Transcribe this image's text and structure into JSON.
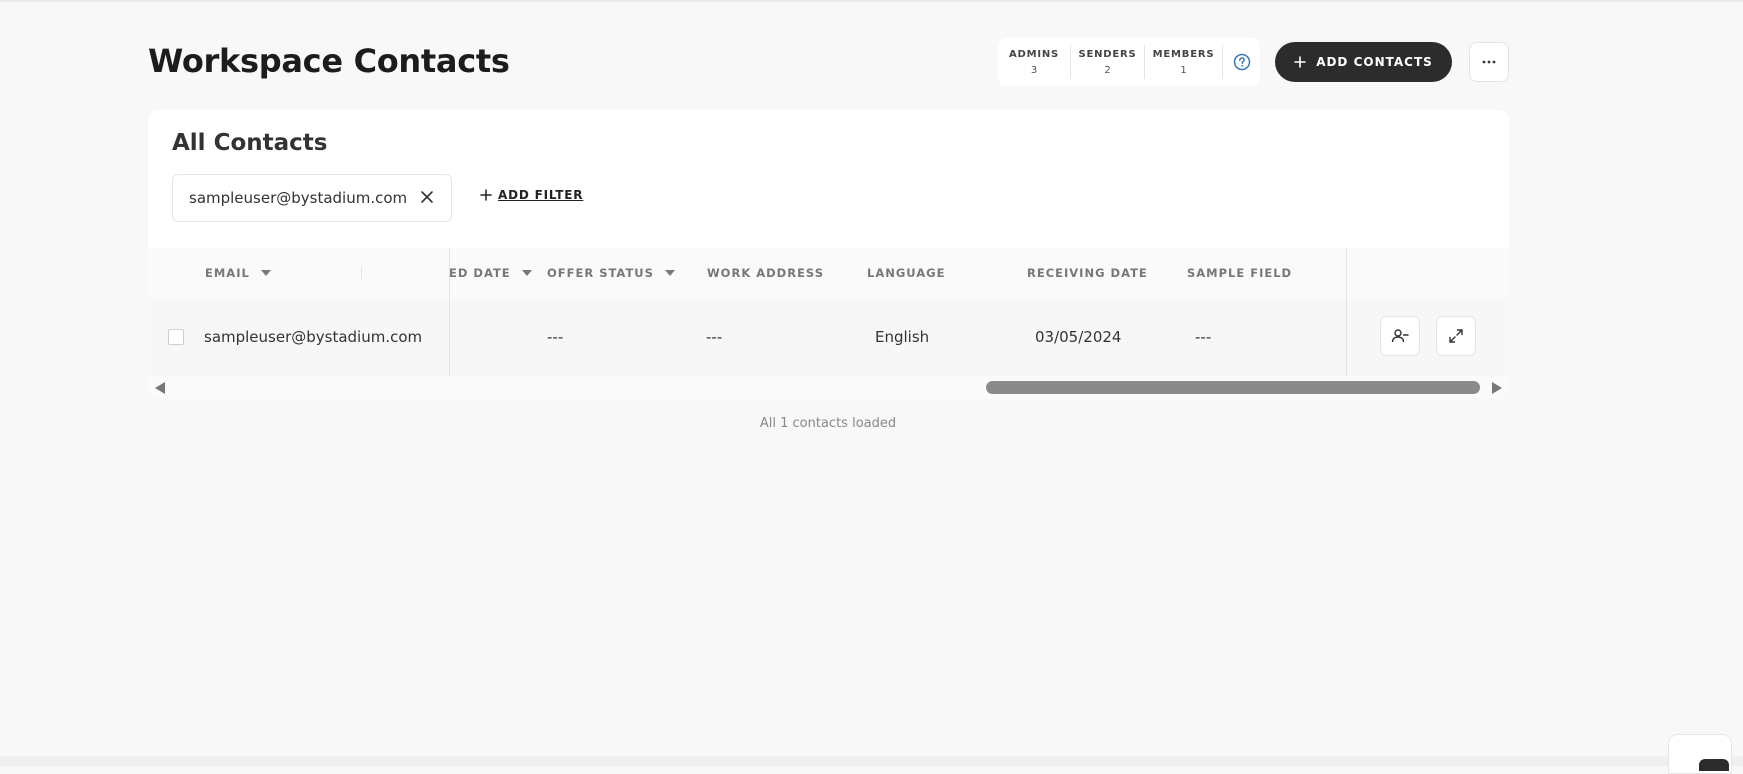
{
  "page": {
    "title": "Workspace Contacts"
  },
  "stats": {
    "admins_label": "ADMINS",
    "admins_value": "3",
    "senders_label": "SENDERS",
    "senders_value": "2",
    "members_label": "MEMBERS",
    "members_value": "1"
  },
  "toolbar": {
    "add_contacts_label": "ADD CONTACTS"
  },
  "contacts": {
    "heading": "All Contacts",
    "filter_value": "sampleuser@bystadium.com",
    "add_filter_label": "ADD FILTER",
    "columns": {
      "email": "EMAIL",
      "created_date": "ED DATE",
      "offer_status": "OFFER STATUS",
      "work_address": "WORK ADDRESS",
      "language": "LANGUAGE",
      "receiving_date": "RECEIVING DATE",
      "sample_field": "SAMPLE FIELD"
    },
    "rows": [
      {
        "email": "sampleuser@bystadium.com",
        "offer_status": "---",
        "work_address": "---",
        "language": "English",
        "receiving_date": "03/05/2024",
        "sample_field": "---"
      }
    ],
    "loaded_text": "All 1 contacts loaded"
  },
  "icons": {
    "help": "question-circle-icon",
    "add": "plus-icon",
    "more": "ellipsis-icon",
    "close": "close-icon",
    "caret": "caret-down-icon",
    "remove_user": "user-minus-icon",
    "expand": "expand-icon"
  },
  "colors": {
    "primary_button": "#2c2c2c",
    "help_icon": "#3a79b8",
    "background": "#f8f8f8"
  }
}
